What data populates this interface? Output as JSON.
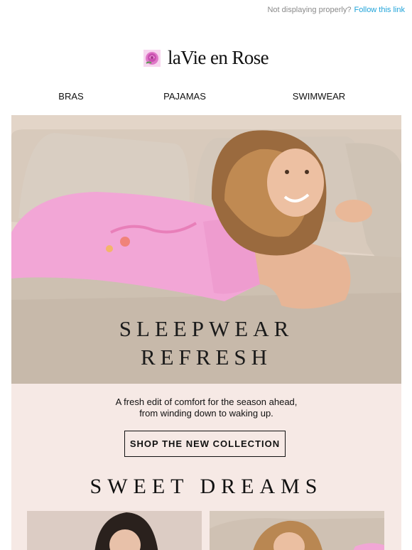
{
  "preheader": {
    "text": "Not displaying properly?",
    "link": "Follow this link"
  },
  "brand": {
    "name": "laVie en Rose",
    "logo_icon": "rose-icon"
  },
  "nav": {
    "items": [
      {
        "label": "BRAS"
      },
      {
        "label": "PAJAMAS"
      },
      {
        "label": "SWIMWEAR"
      }
    ]
  },
  "hero": {
    "title_line1": "SLEEPWEAR",
    "title_line2": "REFRESH"
  },
  "promo": {
    "tagline_line1": "A fresh edit of comfort for the season ahead,",
    "tagline_line2": "from winding down to waking up.",
    "cta_label": "SHOP THE NEW COLLECTION",
    "section_title": "SWEET DREAMS"
  },
  "colors": {
    "link": "#1fa3d9",
    "promo_background": "#f6e9e5",
    "pajama_pink": "#f2a6d6"
  }
}
